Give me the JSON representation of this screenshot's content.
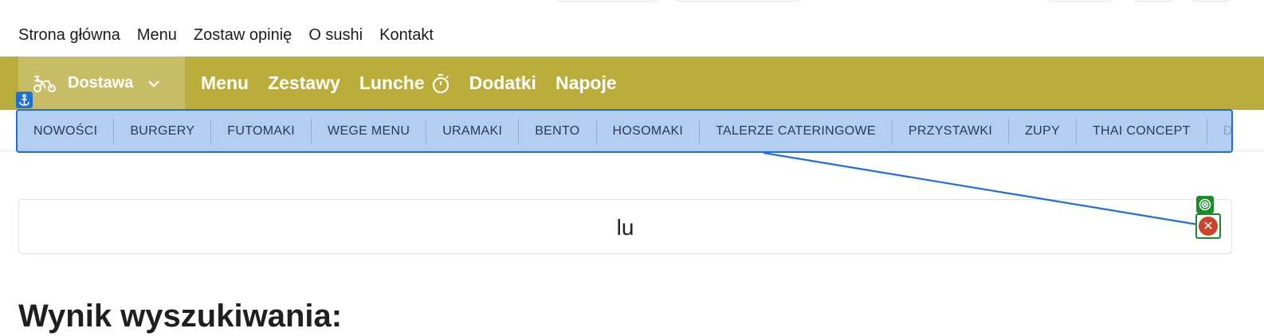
{
  "top_nav": [
    {
      "label": "Strona główna"
    },
    {
      "label": "Menu"
    },
    {
      "label": "Zostaw opinię"
    },
    {
      "label": "O sushi"
    },
    {
      "label": "Kontakt"
    }
  ],
  "main_bar": {
    "delivery_label": "Dostawa",
    "links": [
      {
        "label": "Menu"
      },
      {
        "label": "Zestawy"
      },
      {
        "label": "Lunche"
      },
      {
        "label": "Dodatki"
      },
      {
        "label": "Napoje"
      }
    ]
  },
  "categories": [
    "NOWOŚCI",
    "BURGERY",
    "FUTOMAKI",
    "WEGE MENU",
    "URAMAKI",
    "BENTO",
    "HOSOMAKI",
    "TALERZE CATERINGOWE",
    "PRZYSTAWKI",
    "ZUPY",
    "THAI CONCEPT",
    "DES"
  ],
  "search": {
    "value": "lu"
  },
  "results": {
    "title": "Wynik wyszukiwania:"
  },
  "icons": {
    "delivery": "scooter-icon",
    "chevron": "chevron-down-icon",
    "lunch": "stopwatch-icon",
    "anchor": "anchor-icon",
    "target": "target-icon",
    "clear": "close-icon"
  },
  "colors": {
    "main_bar": "#bbad3b",
    "delivery_bg": "#c8bd66",
    "overlay": "#1e6fd8",
    "clear": "#c9452b",
    "target": "#1a8c2a"
  }
}
